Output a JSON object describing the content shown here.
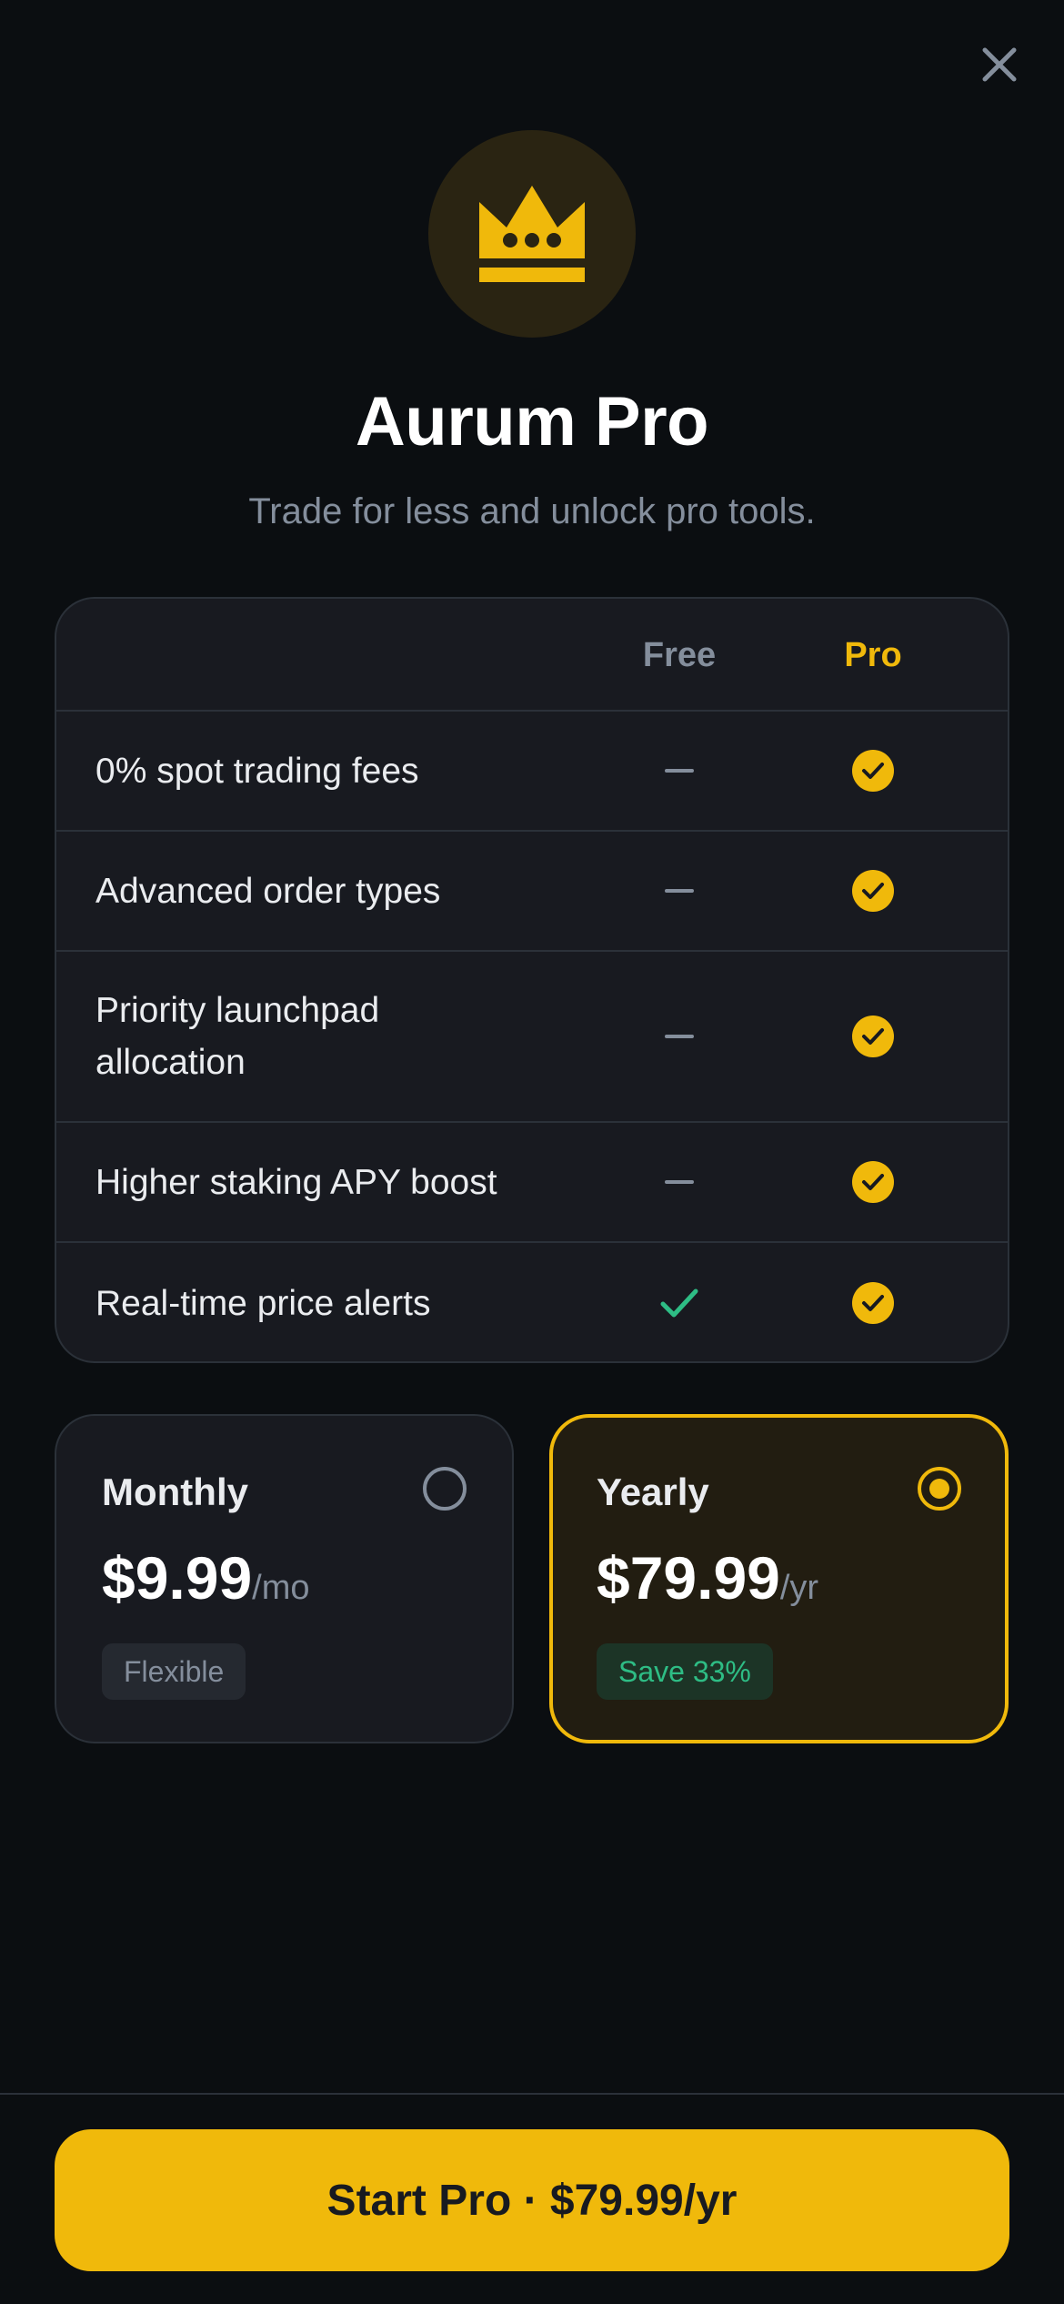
{
  "header": {
    "close_icon": "close-icon",
    "crown_icon": "crown-icon",
    "title": "Aurum Pro",
    "subtitle": "Trade for less and unlock pro tools."
  },
  "comparison": {
    "columns": [
      "Free",
      "Pro"
    ],
    "rows": [
      {
        "label": "0% spot trading fees",
        "free": "dash",
        "pro": "check"
      },
      {
        "label": "Advanced order types",
        "free": "dash",
        "pro": "check"
      },
      {
        "label": "Priority launchpad allocation",
        "free": "dash",
        "pro": "check"
      },
      {
        "label": "Higher staking APY boost",
        "free": "dash",
        "pro": "check"
      },
      {
        "label": "Real-time price alerts",
        "free": "check",
        "pro": "check"
      }
    ]
  },
  "plans": {
    "monthly": {
      "name": "Monthly",
      "price": "$9.99",
      "period": "/mo",
      "tag": "Flexible",
      "selected": false
    },
    "yearly": {
      "name": "Yearly",
      "price": "$79.99",
      "period": "/yr",
      "tag": "Save 33%",
      "selected": true
    }
  },
  "cta": {
    "label": "Start Pro · $79.99/yr"
  },
  "colors": {
    "accent": "#f0b90b",
    "success": "#2ebd85",
    "background": "#0b0e11",
    "card": "#181a20"
  }
}
